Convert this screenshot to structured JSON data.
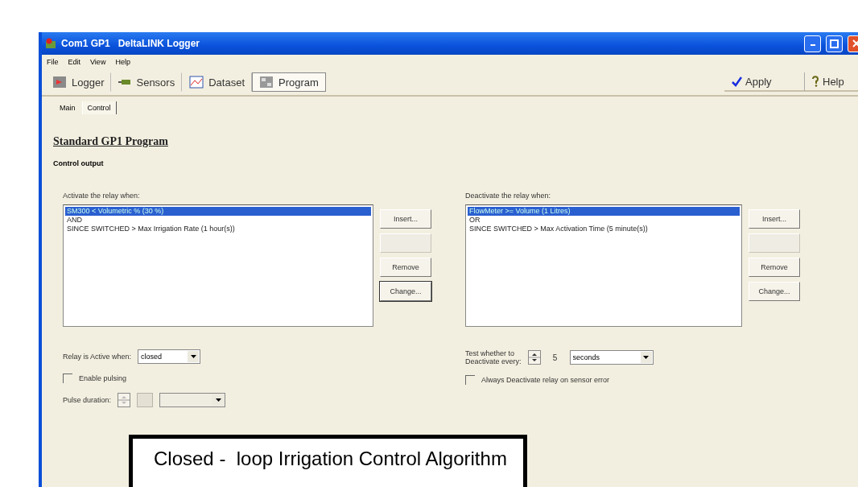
{
  "window": {
    "title": "Com1 GP1   DeltaLINK Logger"
  },
  "menu": [
    "File",
    "Edit",
    "View",
    "Help"
  ],
  "toolbar": {
    "items": [
      {
        "label": "Logger",
        "selected": false
      },
      {
        "label": "Sensors",
        "selected": false
      },
      {
        "label": "Dataset",
        "selected": false
      },
      {
        "label": "Program",
        "selected": true
      }
    ],
    "actions": [
      {
        "label": "Apply"
      },
      {
        "label": "Help"
      }
    ]
  },
  "tabs": [
    {
      "label": "Main",
      "selected": false
    },
    {
      "label": "Control",
      "selected": true
    }
  ],
  "heading": "Standard GP1 Program",
  "section": "Control output",
  "groups": [
    {
      "label": "Activate the relay when:",
      "items": [
        {
          "text": "SM300 < Volumetric % (30 %)",
          "selected": true
        },
        {
          "text": "AND",
          "selected": false
        },
        {
          "text": "SINCE SWITCHED > Max Irrigation Rate (1 hour(s))",
          "selected": false
        }
      ],
      "buttons": [
        {
          "label": "Insert...",
          "disabled": false,
          "focused": false
        },
        {
          "disabled": true,
          "focused": false
        },
        {
          "label": "Remove",
          "disabled": false,
          "focused": false
        },
        {
          "label": "Change...",
          "disabled": false,
          "focused": true
        }
      ]
    },
    {
      "label": "Deactivate the relay when:",
      "items": [
        {
          "text": "FlowMeter >= Volume (1 Litres)",
          "selected": true
        },
        {
          "text": "OR",
          "selected": false
        },
        {
          "text": "SINCE SWITCHED > Max Activation Time (5 minute(s))",
          "selected": false
        }
      ],
      "buttons": [
        {
          "label": "Insert...",
          "disabled": false,
          "focused": false
        },
        {
          "disabled": true,
          "focused": false
        },
        {
          "label": "Remove",
          "disabled": false,
          "focused": false
        },
        {
          "label": "Change...",
          "disabled": false,
          "focused": false
        }
      ]
    }
  ],
  "relay_active": {
    "label": "Relay is Active when:",
    "value": "closed"
  },
  "pulsing": {
    "label": "Enable pulsing",
    "checked": false
  },
  "pulse_duration": {
    "label": "Pulse duration:",
    "disabled": true
  },
  "test_every": {
    "label_lines": [
      "Test whether to",
      "Deactivate every:"
    ],
    "value": "5",
    "unit": "seconds"
  },
  "always_deactivate": {
    "label": "Always Deactivate relay on sensor error",
    "checked": false
  },
  "caption": "Closed -  loop Irrigation Control Algorithm"
}
